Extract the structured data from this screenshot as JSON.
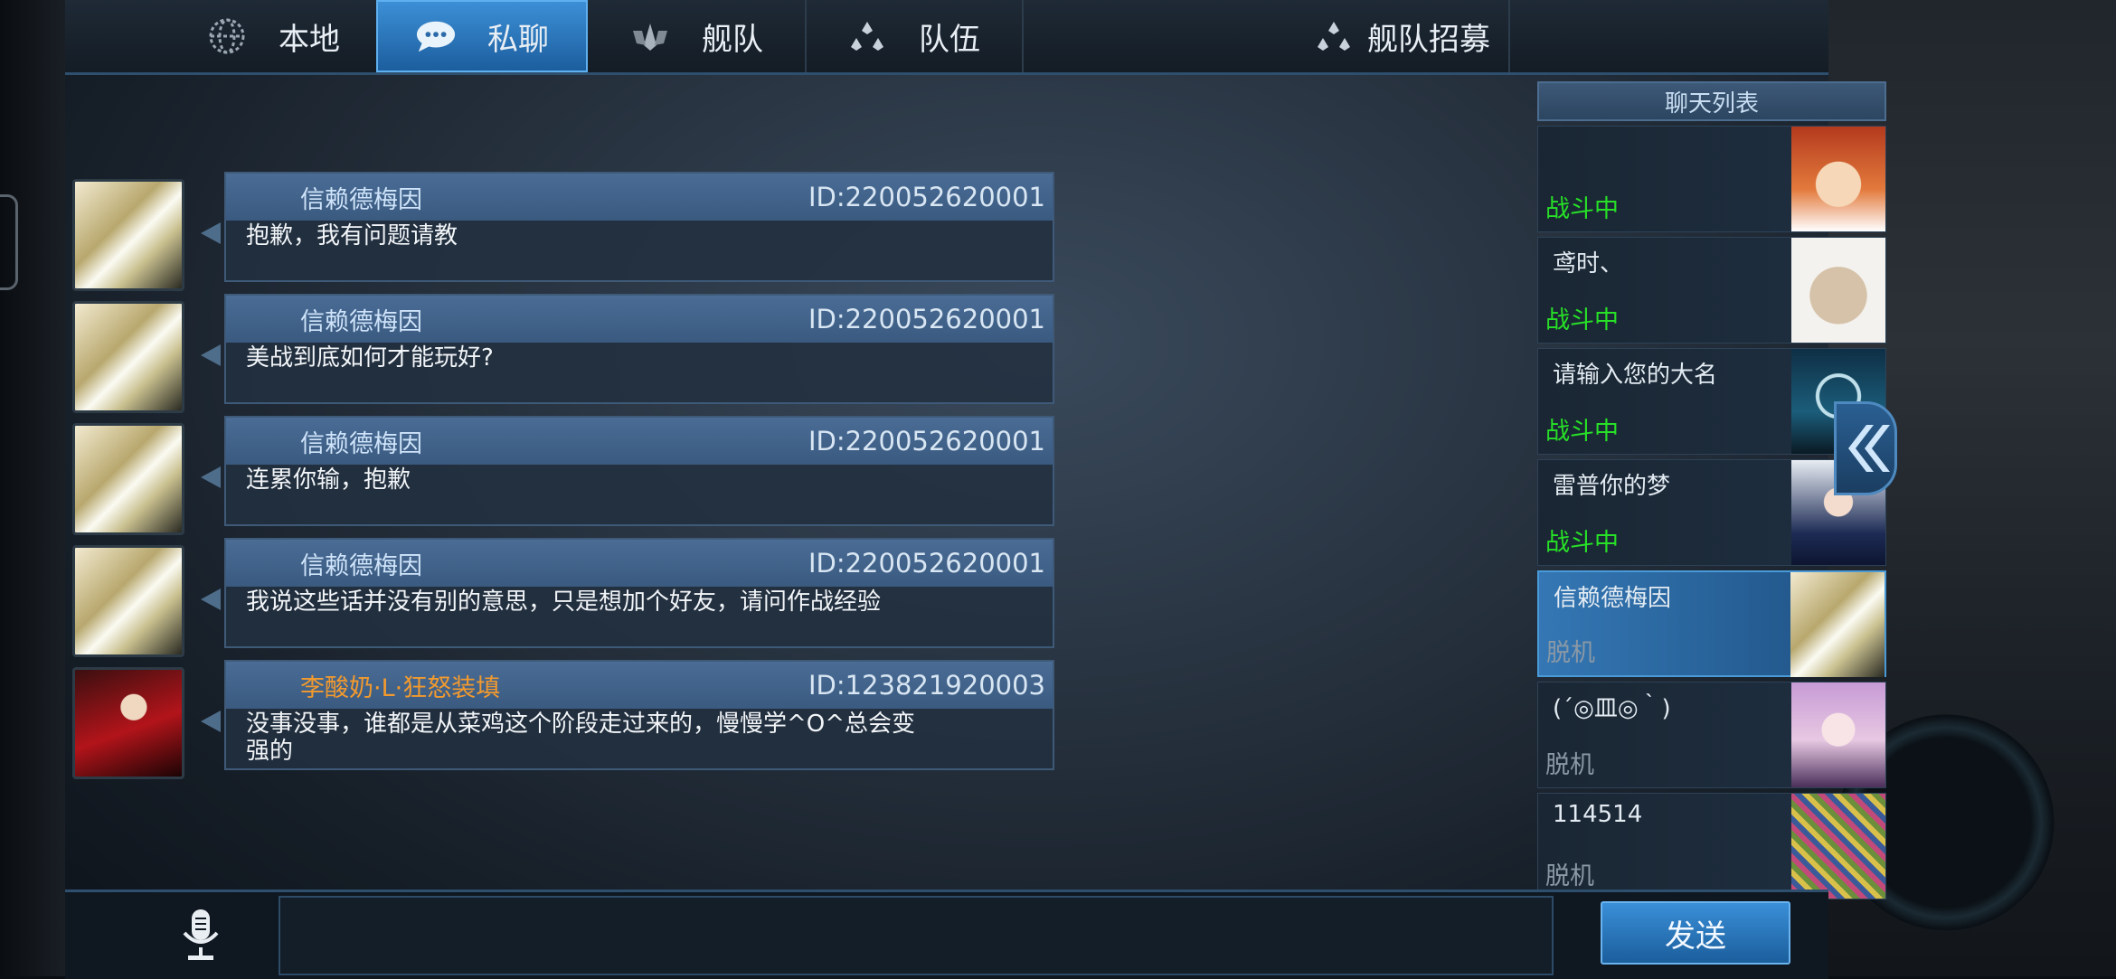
{
  "tabs": [
    {
      "label": "本地",
      "icon": "globe-icon"
    },
    {
      "label": "私聊",
      "icon": "chat-bubble-icon",
      "active": true
    },
    {
      "label": "舰队",
      "icon": "fleet-emblem-icon"
    },
    {
      "label": "队伍",
      "icon": "team-dots-icon"
    },
    {
      "label": "舰队招募",
      "icon": "recruit-dots-icon"
    }
  ],
  "messages": [
    {
      "name": "信赖德梅因",
      "id": "ID:220052620001",
      "text": "抱歉，我有问题请教"
    },
    {
      "name": "信赖德梅因",
      "id": "ID:220052620001",
      "text": "美战到底如何才能玩好?"
    },
    {
      "name": "信赖德梅因",
      "id": "ID:220052620001",
      "text": "连累你输，抱歉"
    },
    {
      "name": "信赖德梅因",
      "id": "ID:220052620001",
      "text": "我说这些话并没有别的意思，只是想加个好友，请问作战经验"
    },
    {
      "name": "李酸奶·L·狂怒装填",
      "id": "ID:123821920003",
      "text": "没事没事，谁都是从菜鸡这个阶段走过来的，慢慢学^O^总会变强的"
    }
  ],
  "chat_list": {
    "title": "聊天列表",
    "items": [
      {
        "name": "",
        "status": "战斗中"
      },
      {
        "name": "鸢时、",
        "status": "战斗中"
      },
      {
        "name": "请输入您的大名",
        "status": "战斗中"
      },
      {
        "name": "雷普你的梦",
        "status": "战斗中"
      },
      {
        "name": "信赖德梅因",
        "status": "脱机",
        "active": true
      },
      {
        "name": "(´◎皿◎｀)",
        "status": "脱机"
      },
      {
        "name": "114514",
        "status": "脱机"
      }
    ]
  },
  "input": {
    "placeholder": "",
    "value": ""
  },
  "send_label": "发送"
}
